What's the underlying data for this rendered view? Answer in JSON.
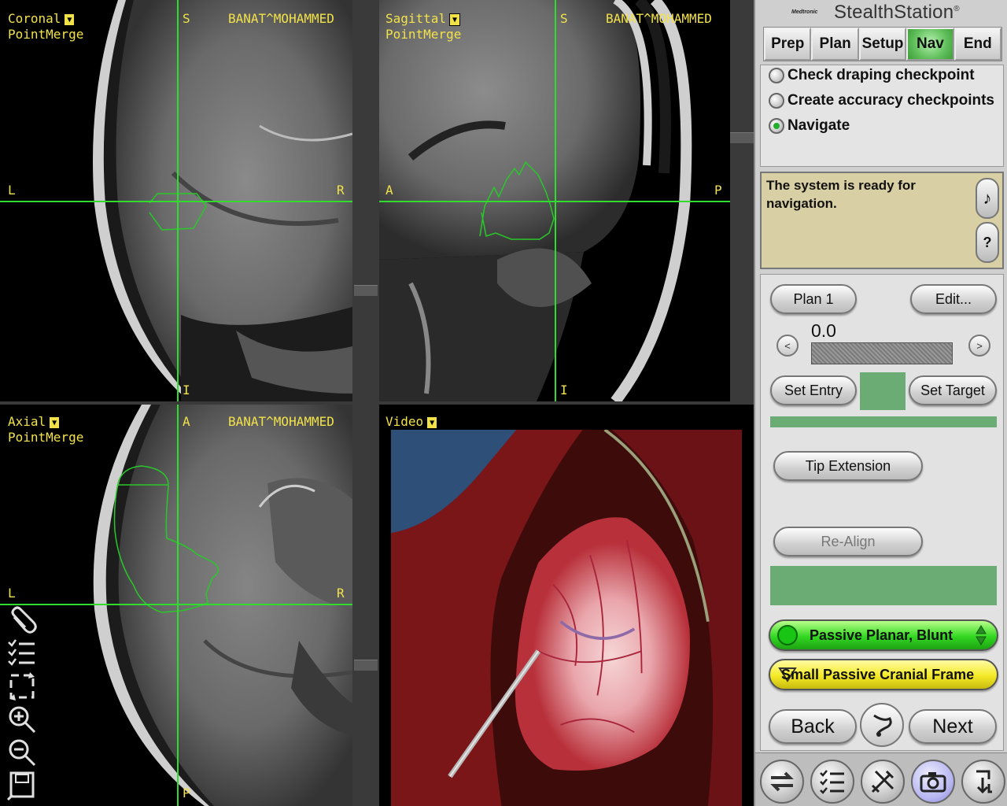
{
  "viewports": {
    "coronal": {
      "view": "Coronal",
      "registration": "PointMerge",
      "patient": "BANAT^MOHAMMED",
      "top": "S",
      "bottom": "I",
      "left": "L",
      "right": "R"
    },
    "sagittal": {
      "view": "Sagittal",
      "registration": "PointMerge",
      "patient": "BANAT^MOHAMMED",
      "top": "S",
      "bottom": "I",
      "left": "A",
      "right": "P"
    },
    "axial": {
      "view": "Axial",
      "registration": "PointMerge",
      "patient": "BANAT^MOHAMMED",
      "top": "A",
      "bottom": "P",
      "left": "L",
      "right": "R"
    },
    "video": {
      "view": "Video"
    }
  },
  "dropdown_glyph": "▼",
  "brand": {
    "logo": "Medtronic",
    "name": "StealthStation",
    "mark": "®"
  },
  "tabs": [
    {
      "label": "Prep"
    },
    {
      "label": "Plan"
    },
    {
      "label": "Setup"
    },
    {
      "label": "Nav"
    },
    {
      "label": "End"
    }
  ],
  "active_tab": "Nav",
  "steps": [
    {
      "label": "Check draping checkpoint",
      "selected": false
    },
    {
      "label": "Create accuracy checkpoints",
      "selected": false
    },
    {
      "label": "Navigate",
      "selected": true
    }
  ],
  "message": "The system is ready for navigation.",
  "message_buttons": {
    "sound": "♪",
    "help": "?"
  },
  "plan": {
    "name_button": "Plan 1",
    "edit_button": "Edit...",
    "value": "0.0",
    "decrease": "<",
    "increase": ">",
    "set_entry": "Set Entry",
    "set_target": "Set Target",
    "tip_extension": "Tip Extension",
    "realign": "Re-Align"
  },
  "instruments": {
    "probe": "Passive Planar, Blunt",
    "frame": "Small Passive Cranial Frame"
  },
  "nav_buttons": {
    "back": "Back",
    "next": "Next"
  },
  "colors": {
    "overlay_text": "#f2e24a",
    "crosshair": "#2fdc2f",
    "tumor_outline": "#29c829",
    "active_tab": "#5fbf5a",
    "message_bg": "#d9cfa4",
    "entry_swatch": "#6aac73"
  },
  "icons": {
    "left_tools": [
      "paperclip-icon",
      "checklist-icon",
      "rotate-icon",
      "zoom-in-icon",
      "zoom-out-icon",
      "save-icon"
    ],
    "bottom": [
      "swap-icon",
      "checklist-icon",
      "tools-icon",
      "camera-icon",
      "exit-icon"
    ]
  }
}
